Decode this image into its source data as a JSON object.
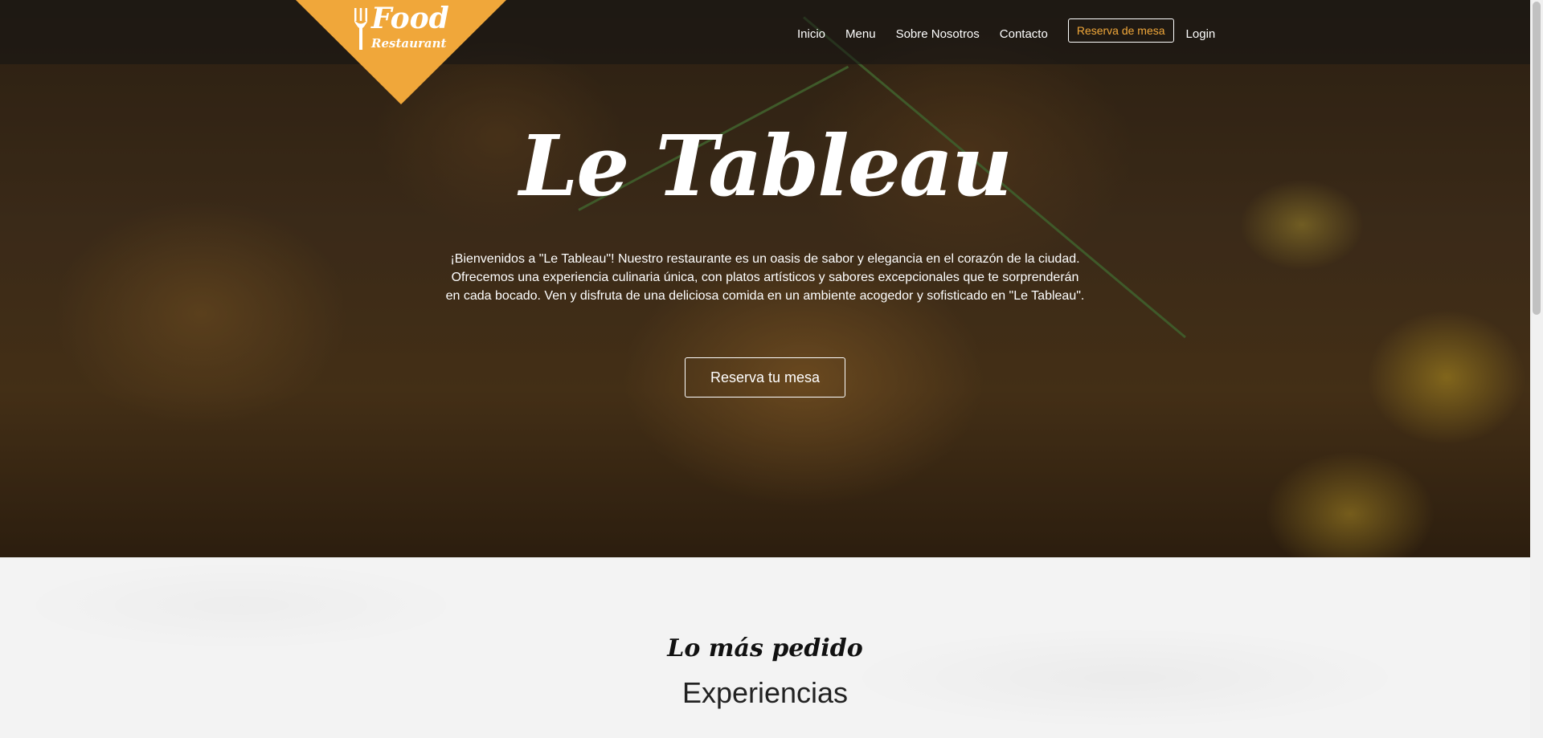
{
  "logo": {
    "line1": "Food",
    "line2": "Restaurant",
    "color": "#f0a73a",
    "icon": "fork-icon"
  },
  "nav": {
    "links": [
      "Inicio",
      "Menu",
      "Sobre Nosotros",
      "Contacto"
    ],
    "reserve_label": "Reserva de mesa",
    "login_label": "Login",
    "accent": "#f0a73a"
  },
  "hero": {
    "title": "Le Tableau",
    "text": "¡Bienvenidos a \"Le Tableau\"! Nuestro restaurante es un oasis de sabor y elegancia en el corazón de la ciudad. Ofrecemos una experiencia culinaria única, con platos artísticos y sabores excepcionales que te sorprenderán en cada bocado. Ven y disfruta de una deliciosa comida en un ambiente acogedor y sofisticado en \"Le Tableau\".",
    "button_label": "Reserva tu mesa"
  },
  "section": {
    "subtitle": "Lo más pedido",
    "title": "Experiencias"
  }
}
